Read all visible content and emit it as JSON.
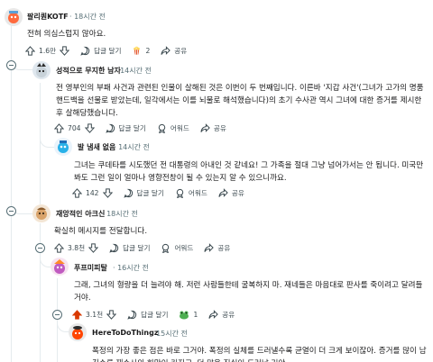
{
  "comments": [
    {
      "username": "팔리퀀KOTF",
      "time": "18시간 전",
      "body": "전혀 의심스럽지 않아요.",
      "votes": "1.6만",
      "reply": "답글 달기",
      "award_count": "2",
      "share": "공유"
    },
    {
      "username": "성적으로 무지한 남자",
      "time": "14시간 전",
      "body": "전 영부인의 부패 사건과 관련된 인물이 살해된 것은 이번이 두 번째입니다. 이른바 '지갑 사건'(그녀가 고가의 명품 핸드백을 선물로 받았는데, 일각에서는 이를 뇌물로 해석했습니다)의 초기 수사관 역시 그녀에 대한 증거를 제시한 후 살해당했습니다.",
      "votes": "704",
      "reply": "답글 달기",
      "award": "어워드",
      "share": "공유"
    },
    {
      "username": "발 냄새 없음",
      "time": "14시간 전",
      "body": "그녀는 쿠데타를 시도했던 전 대통령의 아내인 것 같네요! 그 가족을 절대 그냥 넘어가서는 안 됩니다. 미국만 봐도 그런 일이 얼마나 영향전창이 될 수 있는지 알 수 있으니까요.",
      "votes": "142",
      "reply": "답글 달기",
      "award": "어워드",
      "share": "공유"
    },
    {
      "username": "재앙적인 아크신",
      "time": "18시간 전",
      "body": "확실히 메시지를 전달합니다.",
      "votes": "3.8천",
      "reply": "답글 달기",
      "award": "어워드",
      "share": "공유"
    },
    {
      "username": "푸프미피탈",
      "time": "16시간 전",
      "body": "그래, 그녀의 형량을 더 늘려야 해. 저런 사람들한테 굴복하지 마. 재네들은 마음대로 판사를 죽이려고 달려들거야.",
      "votes": "3.1천",
      "reply": "답글 달기",
      "award_count": "1",
      "share": "공유"
    },
    {
      "username": "HereToDoThingz",
      "time": "15시간 전",
      "body": "폭정의 가장 좋은 점은 바로 그거야. 폭정의 실체를 드러낼수록 균열이 더 크게 보이잖아. 증거를 많이 남길수록 재수사의 희망이 커지고, 더 많은 진실이 드러날 거야."
    }
  ],
  "colors": {
    "upvote_active": "#d93900",
    "text": "#1a1a1b",
    "meta": "#576f76",
    "thread": "#e5ebee"
  }
}
